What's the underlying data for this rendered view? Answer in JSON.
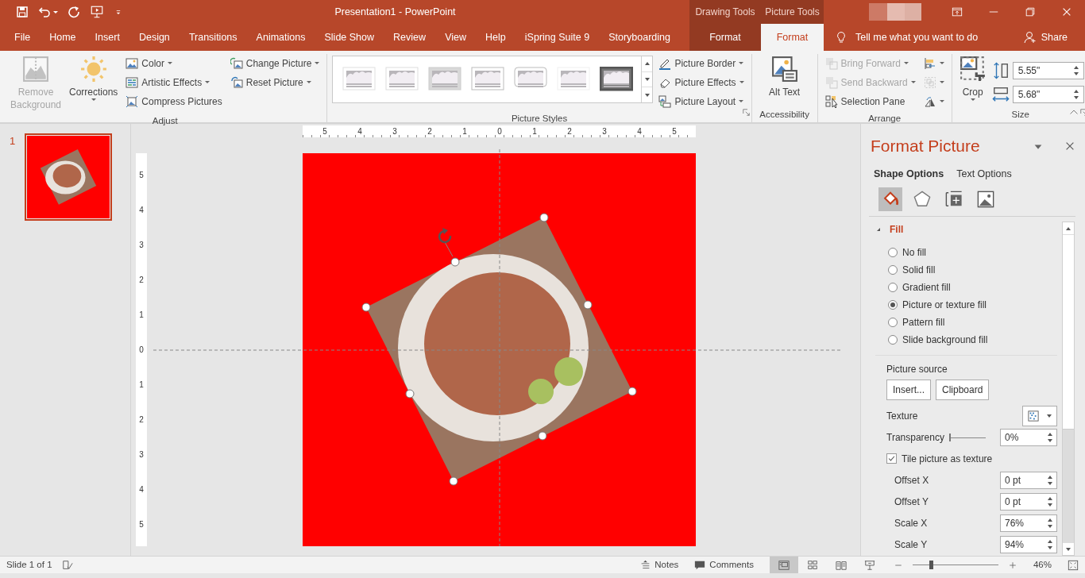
{
  "window": {
    "title": "Presentation1  -  PowerPoint"
  },
  "context_headers": [
    {
      "label": "Drawing Tools"
    },
    {
      "label": "Picture Tools"
    }
  ],
  "tabs": [
    {
      "label": "File",
      "selected": false,
      "contextual": false
    },
    {
      "label": "Home",
      "selected": false,
      "contextual": false
    },
    {
      "label": "Insert",
      "selected": false,
      "contextual": false
    },
    {
      "label": "Design",
      "selected": false,
      "contextual": false
    },
    {
      "label": "Transitions",
      "selected": false,
      "contextual": false
    },
    {
      "label": "Animations",
      "selected": false,
      "contextual": false
    },
    {
      "label": "Slide Show",
      "selected": false,
      "contextual": false
    },
    {
      "label": "Review",
      "selected": false,
      "contextual": false
    },
    {
      "label": "View",
      "selected": false,
      "contextual": false
    },
    {
      "label": "Help",
      "selected": false,
      "contextual": false
    },
    {
      "label": "iSpring Suite 9",
      "selected": false,
      "contextual": false
    },
    {
      "label": "Storyboarding",
      "selected": false,
      "contextual": false
    },
    {
      "label": "Format",
      "selected": false,
      "contextual": true
    },
    {
      "label": "Format",
      "selected": true,
      "contextual": true
    }
  ],
  "tell_me": {
    "placeholder": "Tell me what you want to do"
  },
  "share": "Share",
  "ribbon_groups": [
    {
      "label": "Adjust",
      "launcher": false,
      "columns": [
        [
          {
            "kind": "large",
            "label": "Remove Background",
            "disabled": true,
            "dropdown": false
          }
        ],
        [
          {
            "kind": "large",
            "label": "Corrections",
            "disabled": false,
            "dropdown": true
          }
        ],
        [
          {
            "kind": "small",
            "label": "Color",
            "disabled": false,
            "dropdown": true
          },
          {
            "kind": "small",
            "label": "Artistic Effects",
            "disabled": false,
            "dropdown": true
          },
          {
            "kind": "small",
            "label": "Compress Pictures",
            "disabled": false,
            "dropdown": false
          }
        ],
        [
          {
            "kind": "small",
            "label": "Change Picture",
            "disabled": false,
            "dropdown": true
          },
          {
            "kind": "small",
            "label": "Reset Picture",
            "disabled": false,
            "dropdown": true
          }
        ]
      ]
    },
    {
      "label": "Picture Styles",
      "launcher": true,
      "columns": [
        [
          {
            "kind": "gallery"
          }
        ],
        [
          {
            "kind": "small",
            "label": "Picture Border",
            "disabled": false,
            "dropdown": true
          },
          {
            "kind": "small",
            "label": "Picture Effects",
            "disabled": false,
            "dropdown": true
          },
          {
            "kind": "small",
            "label": "Picture Layout",
            "disabled": false,
            "dropdown": true
          }
        ]
      ]
    },
    {
      "label": "Accessibility",
      "launcher": false,
      "columns": [
        [
          {
            "kind": "large",
            "label": "Alt Text",
            "disabled": false,
            "dropdown": false
          }
        ]
      ]
    },
    {
      "label": "Arrange",
      "launcher": false,
      "columns": [
        [
          {
            "kind": "small",
            "label": "Bring Forward",
            "disabled": true,
            "dropdown": true
          },
          {
            "kind": "small",
            "label": "Send Backward",
            "disabled": true,
            "dropdown": true
          },
          {
            "kind": "small",
            "label": "Selection Pane",
            "disabled": false,
            "dropdown": false
          }
        ],
        [
          {
            "kind": "icon",
            "disabled": false,
            "dropdown": true
          },
          {
            "kind": "icon",
            "disabled": true,
            "dropdown": true
          },
          {
            "kind": "icon",
            "disabled": false,
            "dropdown": true
          }
        ]
      ]
    },
    {
      "label": "Size",
      "launcher": true,
      "columns": [
        [
          {
            "kind": "large",
            "label": "Crop",
            "disabled": false,
            "dropdown": true
          }
        ],
        [
          {
            "kind": "spin",
            "value": "5.55\""
          },
          {
            "kind": "spin",
            "value": "5.68\""
          }
        ]
      ]
    }
  ],
  "slides": [
    {
      "number": "1",
      "selected": true
    }
  ],
  "rulers": {
    "horizontal": [
      "5",
      "4",
      "3",
      "2",
      "1",
      "0",
      "1",
      "2",
      "3",
      "4",
      "5"
    ],
    "vertical": [
      "5",
      "4",
      "3",
      "2",
      "1",
      "0",
      "1",
      "2",
      "3",
      "4",
      "5"
    ]
  },
  "format_pane": {
    "title": "Format Picture",
    "option_tabs": [
      {
        "label": "Shape Options",
        "selected": true
      },
      {
        "label": "Text Options",
        "selected": false
      }
    ],
    "icon_tabs": [
      {
        "selected": true
      },
      {
        "selected": false
      },
      {
        "selected": false
      },
      {
        "selected": false
      }
    ],
    "section": {
      "label": "Fill",
      "expanded": true,
      "options": [
        {
          "label": "No fill",
          "selected": false
        },
        {
          "label": "Solid fill",
          "selected": false
        },
        {
          "label": "Gradient fill",
          "selected": false
        },
        {
          "label": "Picture or texture fill",
          "selected": true
        },
        {
          "label": "Pattern fill",
          "selected": false
        },
        {
          "label": "Slide background fill",
          "selected": false
        }
      ],
      "picture_source": {
        "label": "Picture source",
        "buttons": [
          "Insert...",
          "Clipboard"
        ]
      },
      "texture": {
        "label": "Texture"
      },
      "transparency": {
        "label": "Transparency",
        "level": 0,
        "value": "0%"
      },
      "tile": {
        "label": "Tile picture as texture",
        "checked": true
      },
      "fields": [
        {
          "label": "Offset X",
          "value": "0 pt"
        },
        {
          "label": "Offset Y",
          "value": "0 pt"
        },
        {
          "label": "Scale X",
          "value": "76%"
        },
        {
          "label": "Scale Y",
          "value": "94%"
        }
      ]
    }
  },
  "status_bar": {
    "slide_info": "Slide 1 of 1",
    "notes": "Notes",
    "comments": "Comments",
    "views": [
      {
        "selected": true
      },
      {
        "selected": false
      },
      {
        "selected": false
      },
      {
        "selected": false
      }
    ],
    "zoom": {
      "level": 0.2,
      "reading": "46%"
    }
  }
}
